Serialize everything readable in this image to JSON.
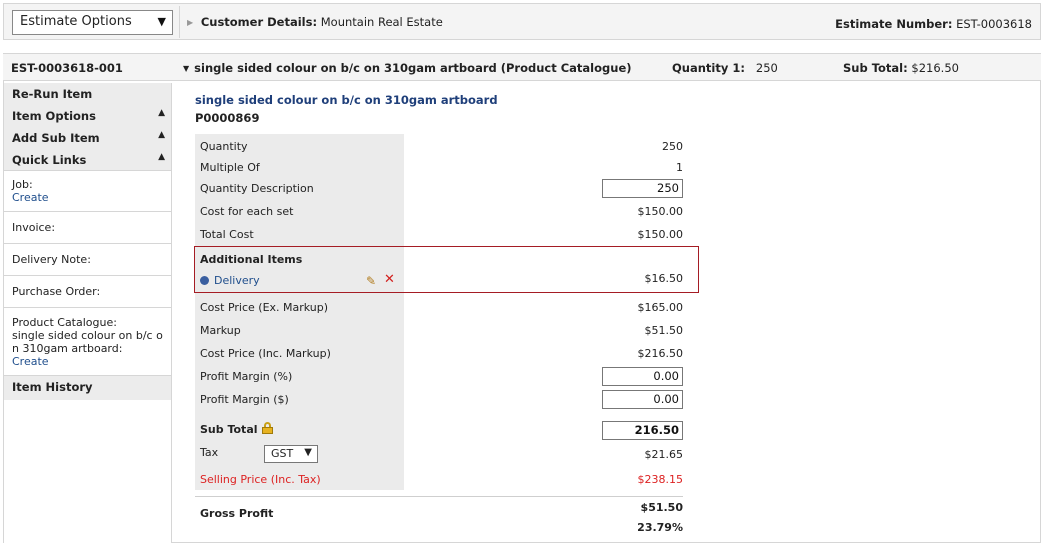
{
  "header": {
    "estimate_options": "Estimate Options",
    "customer_label": "Customer Details:",
    "customer_value": "Mountain Real Estate",
    "estimate_number_label": "Estimate Number:",
    "estimate_number_value": "EST-0003618"
  },
  "item_bar": {
    "code": "EST-0003618-001",
    "description": "single sided colour on b/c on 310gam artboard (Product Catalogue)",
    "quantity_label": "Quantity 1:",
    "quantity_value": "250",
    "subtotal_label": "Sub Total:",
    "subtotal_value": "$216.50"
  },
  "sidebar": {
    "rerun": "Re-Run Item",
    "item_options": "Item Options",
    "add_sub_item": "Add Sub Item",
    "quick_links": "Quick Links",
    "job_label": "Job:",
    "job_link": "Create",
    "invoice_label": "Invoice:",
    "delivery_note_label": "Delivery Note:",
    "purchase_order_label": "Purchase Order:",
    "product_catalogue_label": "Product Catalogue:",
    "product_catalogue_line1": "single sided colour on b/c o",
    "product_catalogue_line2": "n 310gam artboard:",
    "product_catalogue_link": "Create",
    "item_history": "Item History"
  },
  "product": {
    "title": "single sided colour on b/c on 310gam artboard",
    "code": "P0000869"
  },
  "details": {
    "quantity_label": "Quantity",
    "quantity_value": "250",
    "multiple_of_label": "Multiple Of",
    "multiple_of_value": "1",
    "qty_desc_label": "Quantity Description",
    "qty_desc_value": "250",
    "cost_each_label": "Cost for each set",
    "cost_each_value": "$150.00",
    "total_cost_label": "Total Cost",
    "total_cost_value": "$150.00",
    "additional_items_label": "Additional Items",
    "delivery_label": "Delivery",
    "delivery_value": "$16.50",
    "cost_ex_label": "Cost Price (Ex. Markup)",
    "cost_ex_value": "$165.00",
    "markup_label": "Markup",
    "markup_value": "$51.50",
    "cost_inc_label": "Cost Price (Inc. Markup)",
    "cost_inc_value": "$216.50",
    "profit_pct_label": "Profit Margin (%)",
    "profit_pct_value": "0.00",
    "profit_amt_label": "Profit Margin ($)",
    "profit_amt_value": "0.00",
    "subtotal_label": "Sub Total",
    "subtotal_value": "216.50",
    "tax_label": "Tax",
    "tax_option": "GST",
    "tax_value": "$21.65",
    "selling_label": "Selling Price (Inc. Tax)",
    "selling_value": "$238.15",
    "gross_profit_label": "Gross Profit",
    "gross_profit_value": "$51.50",
    "gross_profit_pct": "23.79%"
  },
  "colors": {
    "accent_blue": "#1f3f7a",
    "link_blue": "#1f4e8c",
    "highlight_border": "#a51c24",
    "selling_red": "#dd2222"
  },
  "icons": {
    "estimate_options_arrow": "triangle-down-icon",
    "customer_arrow": "triangle-right-icon",
    "item_desc_arrow": "triangle-down-icon",
    "sidebar_collapse": "triangle-up-icon",
    "delivery_bullet": "blue-dot-icon",
    "edit": "pencil-icon",
    "delete": "red-x-icon",
    "lock": "lock-icon",
    "tax_dropdown": "triangle-down-icon"
  }
}
